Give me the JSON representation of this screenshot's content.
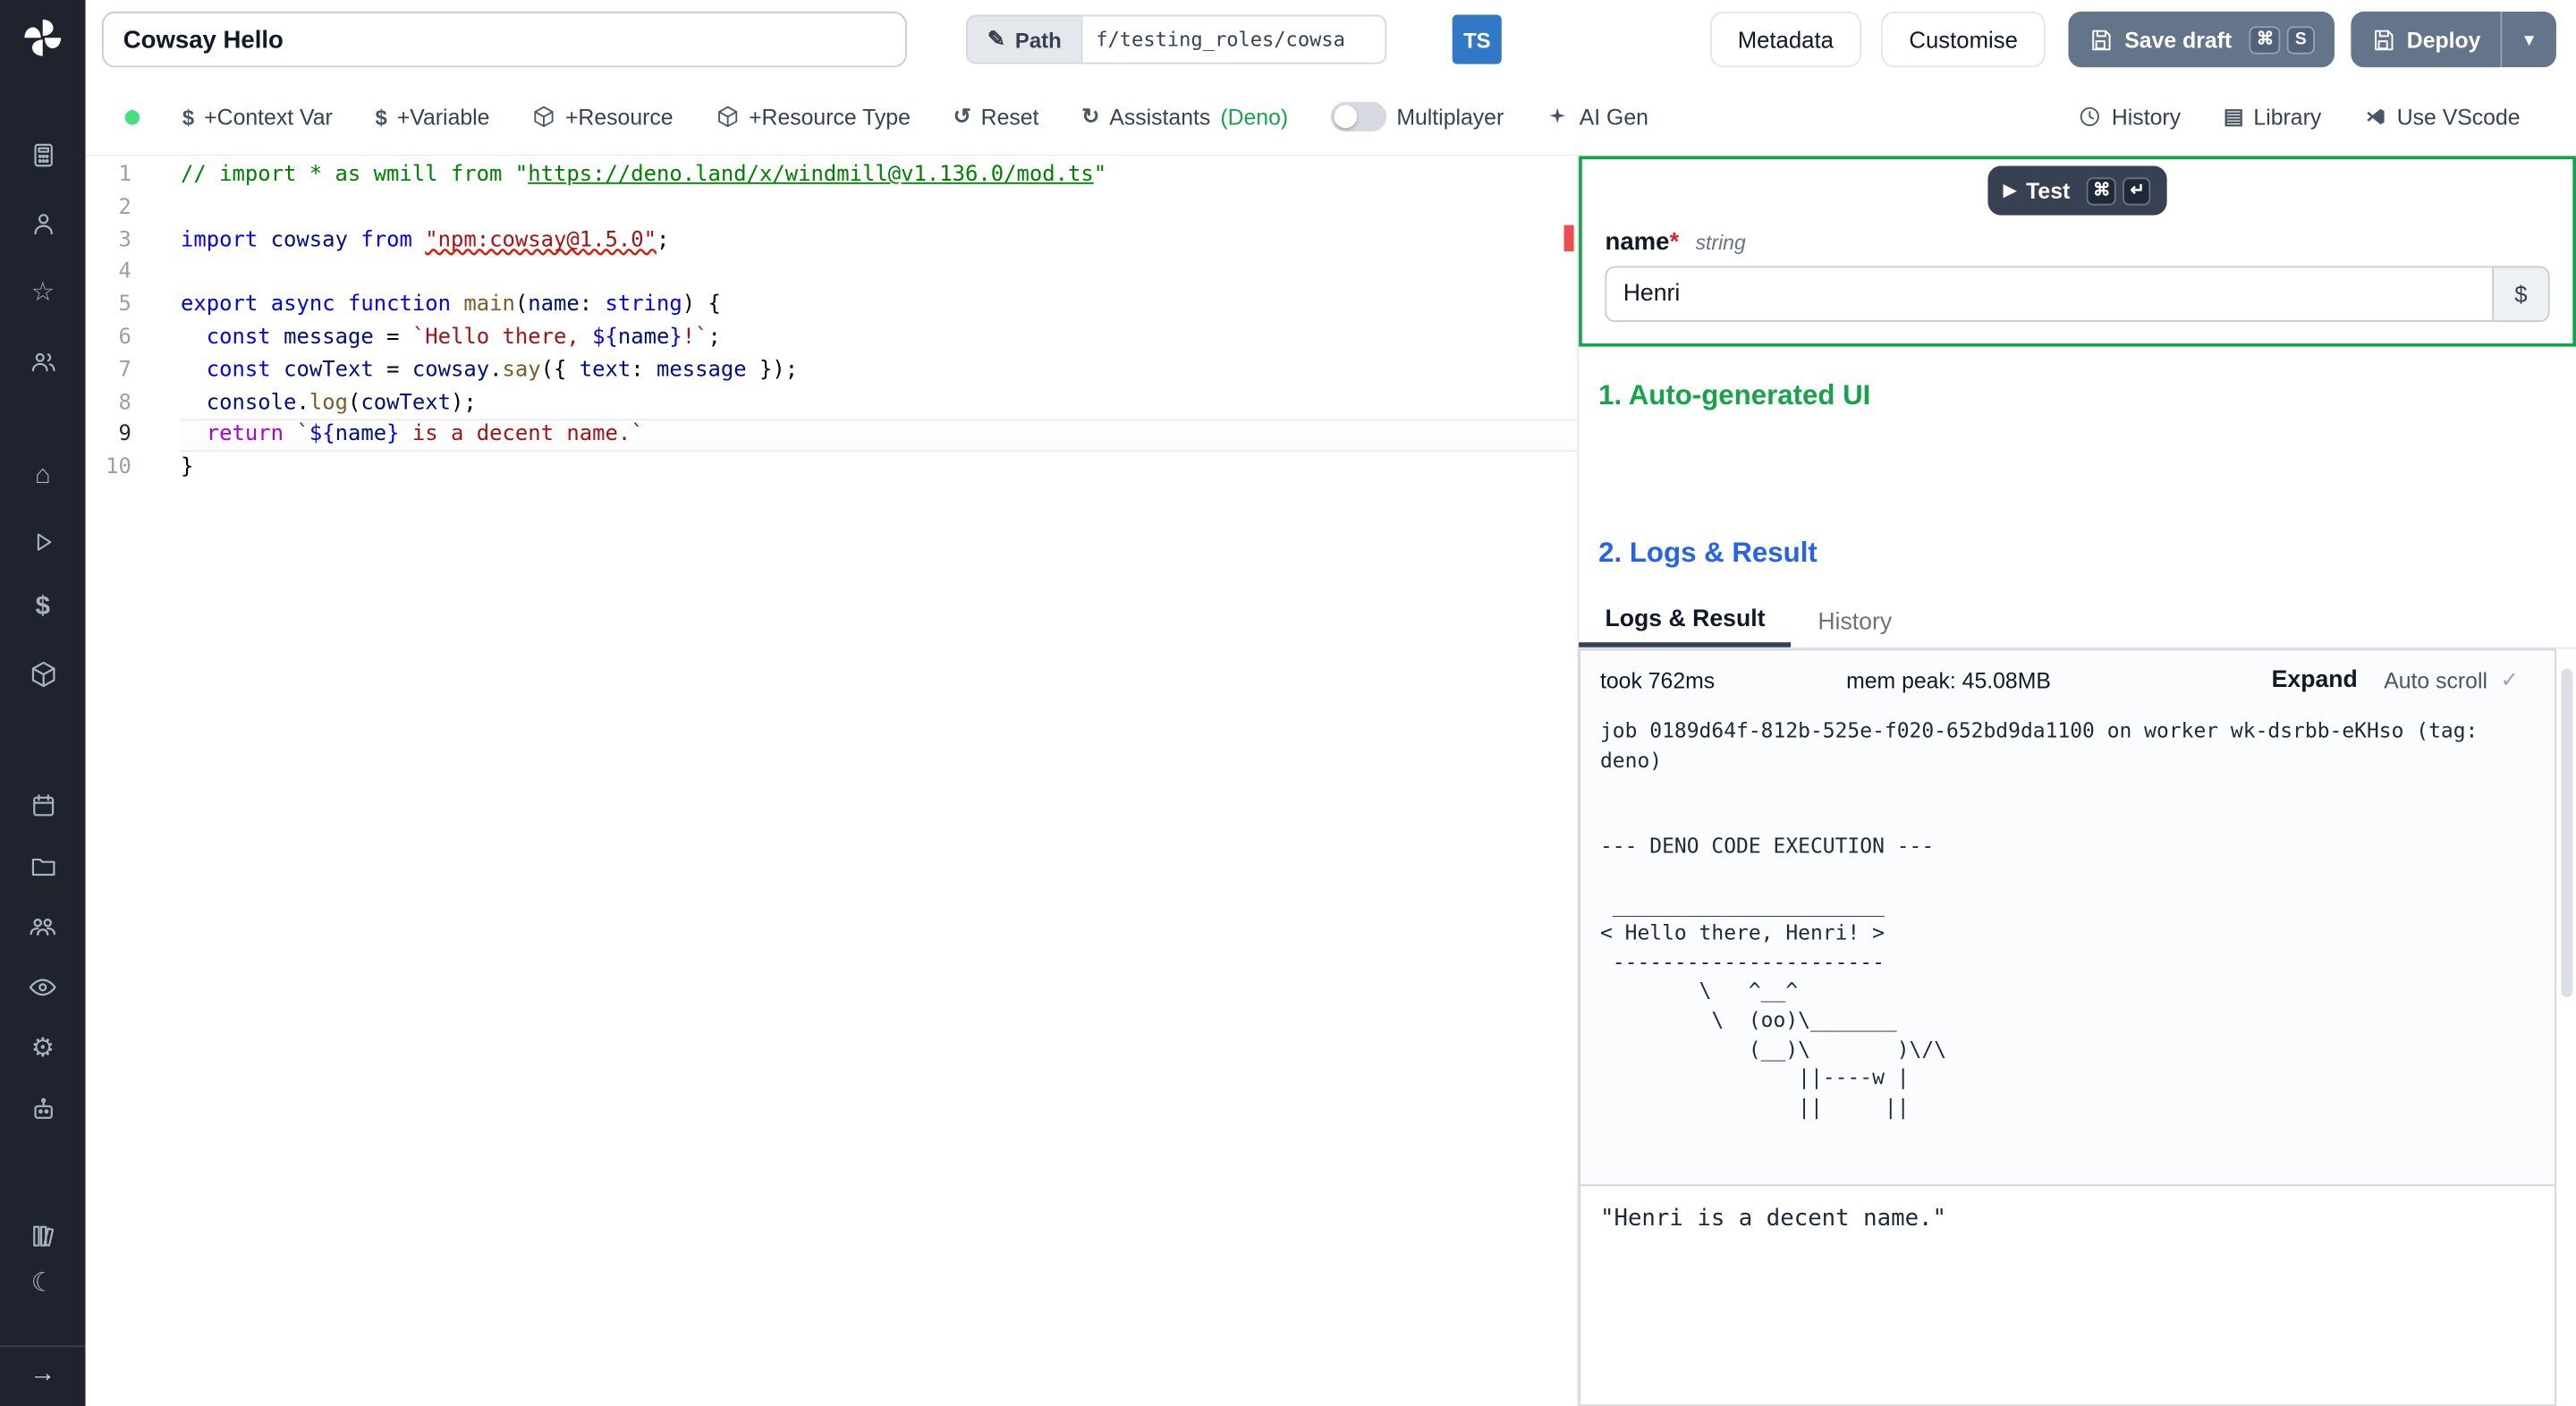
{
  "colors": {
    "accent_green": "#16a34a",
    "accent_blue": "#2563eb",
    "ts_blue": "#3178c6",
    "slate_button": "#64748b",
    "status_dot": "#4ade80",
    "error_red": "#e51400"
  },
  "sidebar": {
    "icon_names": [
      "windmill-logo",
      "calculator-icon",
      "user-icon",
      "star-icon",
      "users-icon",
      "home-icon",
      "play-icon",
      "dollar-icon",
      "box-icon",
      "calendar-icon",
      "folder-icon",
      "user-group-icon",
      "eye-icon",
      "gear-icon",
      "worker-icon",
      "books-icon",
      "moon-icon",
      "arrow-right-icon"
    ]
  },
  "header": {
    "script_name": "Cowsay Hello",
    "path_label": "Path",
    "path_value": "f/testing_roles/cowsa",
    "ts_badge": "TS",
    "metadata": "Metadata",
    "customise": "Customise",
    "save_draft": "Save draft",
    "save_draft_kbd": [
      "⌘",
      "S"
    ],
    "deploy": "Deploy"
  },
  "toolbar": {
    "context_var": "+Context Var",
    "variable": "+Variable",
    "resource": "+Resource",
    "resource_type": "+Resource Type",
    "reset": "Reset",
    "assistants": "Assistants ",
    "assistants_lang": "(Deno)",
    "multiplayer": "Multiplayer",
    "ai_gen": "AI Gen",
    "history": "History",
    "library": "Library",
    "use_vscode": "Use VScode"
  },
  "editor": {
    "language": "typescript",
    "current_line": 9,
    "lines": [
      [
        {
          "c": "cm",
          "t": "// import * as wmill from \""
        },
        {
          "c": "cm lk",
          "t": "https://deno.land/x/windmill@v1.136.0/mod.ts"
        },
        {
          "c": "cm",
          "t": "\""
        }
      ],
      [],
      [
        {
          "c": "kw",
          "t": "import"
        },
        {
          "c": "id",
          "t": " cowsay "
        },
        {
          "c": "kw",
          "t": "from"
        },
        {
          "c": "df",
          "t": " "
        },
        {
          "c": "st er",
          "t": "\"npm:cowsay@1.5.0\""
        },
        {
          "c": "df",
          "t": ";"
        }
      ],
      [],
      [
        {
          "c": "kw",
          "t": "export"
        },
        {
          "c": "df",
          "t": " "
        },
        {
          "c": "kw",
          "t": "async"
        },
        {
          "c": "df",
          "t": " "
        },
        {
          "c": "kw",
          "t": "function"
        },
        {
          "c": "df",
          "t": " "
        },
        {
          "c": "fn",
          "t": "main"
        },
        {
          "c": "df",
          "t": "("
        },
        {
          "c": "id",
          "t": "name"
        },
        {
          "c": "df",
          "t": ": "
        },
        {
          "c": "kw",
          "t": "string"
        },
        {
          "c": "df",
          "t": ") {"
        }
      ],
      [
        {
          "c": "df",
          "t": "  "
        },
        {
          "c": "kw",
          "t": "const"
        },
        {
          "c": "df",
          "t": " "
        },
        {
          "c": "id",
          "t": "message"
        },
        {
          "c": "df",
          "t": " = "
        },
        {
          "c": "st",
          "t": "`Hello there, "
        },
        {
          "c": "kw",
          "t": "${"
        },
        {
          "c": "id",
          "t": "name"
        },
        {
          "c": "kw",
          "t": "}"
        },
        {
          "c": "st",
          "t": "!`"
        },
        {
          "c": "df",
          "t": ";"
        }
      ],
      [
        {
          "c": "df",
          "t": "  "
        },
        {
          "c": "kw",
          "t": "const"
        },
        {
          "c": "df",
          "t": " "
        },
        {
          "c": "id",
          "t": "cowText"
        },
        {
          "c": "df",
          "t": " = "
        },
        {
          "c": "id",
          "t": "cowsay"
        },
        {
          "c": "df",
          "t": "."
        },
        {
          "c": "fn",
          "t": "say"
        },
        {
          "c": "df",
          "t": "({ "
        },
        {
          "c": "id",
          "t": "text"
        },
        {
          "c": "df",
          "t": ": "
        },
        {
          "c": "id",
          "t": "message"
        },
        {
          "c": "df",
          "t": " });"
        }
      ],
      [
        {
          "c": "df",
          "t": "  "
        },
        {
          "c": "id",
          "t": "console"
        },
        {
          "c": "df",
          "t": "."
        },
        {
          "c": "fn",
          "t": "log"
        },
        {
          "c": "df",
          "t": "("
        },
        {
          "c": "id",
          "t": "cowText"
        },
        {
          "c": "df",
          "t": ");"
        }
      ],
      [
        {
          "c": "df",
          "t": "  "
        },
        {
          "c": "kb",
          "t": "return"
        },
        {
          "c": "df",
          "t": " "
        },
        {
          "c": "st",
          "t": "`"
        },
        {
          "c": "kw",
          "t": "${"
        },
        {
          "c": "id",
          "t": "name"
        },
        {
          "c": "kw",
          "t": "}"
        },
        {
          "c": "st",
          "t": " is a decent name.`"
        }
      ],
      [
        {
          "c": "df",
          "t": "}"
        }
      ]
    ]
  },
  "run_panel": {
    "test": "Test",
    "test_kbd": [
      "⌘",
      "↵"
    ],
    "arg": {
      "name": "name",
      "required": "*",
      "type": "string",
      "value": "Henri",
      "var_picker": "$"
    },
    "section_ui": "1. Auto-generated UI",
    "section_logs": "2. Logs & Result",
    "tabs": [
      "Logs & Result",
      "History"
    ],
    "active_tab": "Logs & Result",
    "stats": {
      "took": "took 762ms",
      "mem_peak": "mem peak: 45.08MB",
      "expand": "Expand",
      "auto_scroll": "Auto scroll"
    },
    "log_lines": [
      "job 0189d64f-812b-525e-f020-652bd9da1100 on worker wk-dsrbb-eKHso (tag:",
      "deno)",
      "",
      "",
      "--- DENO CODE EXECUTION ---",
      "",
      " ______________________",
      "< Hello there, Henri! >",
      " ----------------------",
      "        \\   ^__^",
      "         \\  (oo)\\_______",
      "            (__)\\       )\\/\\",
      "                ||----w |",
      "                ||     ||"
    ],
    "result": "\"Henri is a decent name.\""
  }
}
